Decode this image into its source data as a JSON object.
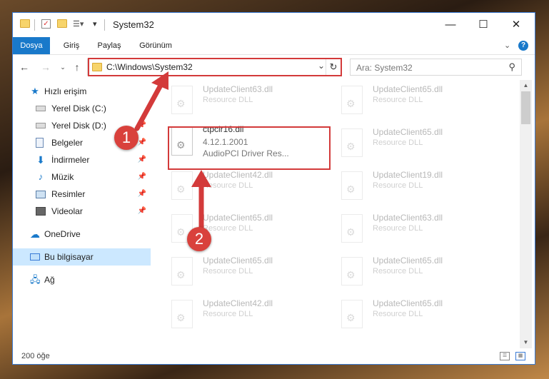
{
  "window": {
    "title": "System32",
    "controls": {
      "minimize": "—",
      "maximize": "☐",
      "close": "✕"
    }
  },
  "ribbon": {
    "tabs": [
      "Dosya",
      "Giriş",
      "Paylaş",
      "Görünüm"
    ]
  },
  "address": {
    "path": "C:\\Windows\\System32",
    "search_placeholder": "Ara: System32"
  },
  "sidebar": {
    "quick_access": "Hızlı erişim",
    "items": [
      {
        "label": "Yerel Disk (C:)",
        "icon": "drive-icon"
      },
      {
        "label": "Yerel Disk (D:)",
        "icon": "drive-icon"
      },
      {
        "label": "Belgeler",
        "icon": "documents-icon"
      },
      {
        "label": "İndirmeler",
        "icon": "downloads-icon"
      },
      {
        "label": "Müzik",
        "icon": "music-icon"
      },
      {
        "label": "Resimler",
        "icon": "pictures-icon"
      },
      {
        "label": "Videolar",
        "icon": "videos-icon"
      }
    ],
    "onedrive": "OneDrive",
    "this_pc": "Bu bilgisayar",
    "network": "Ağ"
  },
  "files": {
    "highlighted": {
      "name": "ctpcir16.dll",
      "version": "4.12.1.2001",
      "type": "AudioPCI Driver Res..."
    },
    "left_column": [
      {
        "name": "UpdateClient63.dll",
        "type": "Resource DLL"
      },
      {
        "name": "UpdateClient42.dll",
        "type": "Resource DLL"
      },
      {
        "name": "UpdateClient65.dll",
        "type": "Resource DLL"
      },
      {
        "name": "UpdateClient65.dll",
        "type": "Resource DLL"
      },
      {
        "name": "UpdateClient42.dll",
        "type": "Resource DLL"
      }
    ],
    "right_column": [
      {
        "name": "UpdateClient65.dll",
        "type": "Resource DLL"
      },
      {
        "name": "UpdateClient65.dll",
        "type": "Resource DLL"
      },
      {
        "name": "UpdateClient19.dll",
        "type": "Resource DLL"
      },
      {
        "name": "UpdateClient63.dll",
        "type": "Resource DLL"
      },
      {
        "name": "UpdateClient65.dll",
        "type": "Resource DLL"
      },
      {
        "name": "UpdateClient65.dll",
        "type": "Resource DLL"
      }
    ]
  },
  "status": {
    "item_count": "200 öğe"
  },
  "annotations": {
    "step1": "1",
    "step2": "2",
    "color": "#d33a3a"
  }
}
